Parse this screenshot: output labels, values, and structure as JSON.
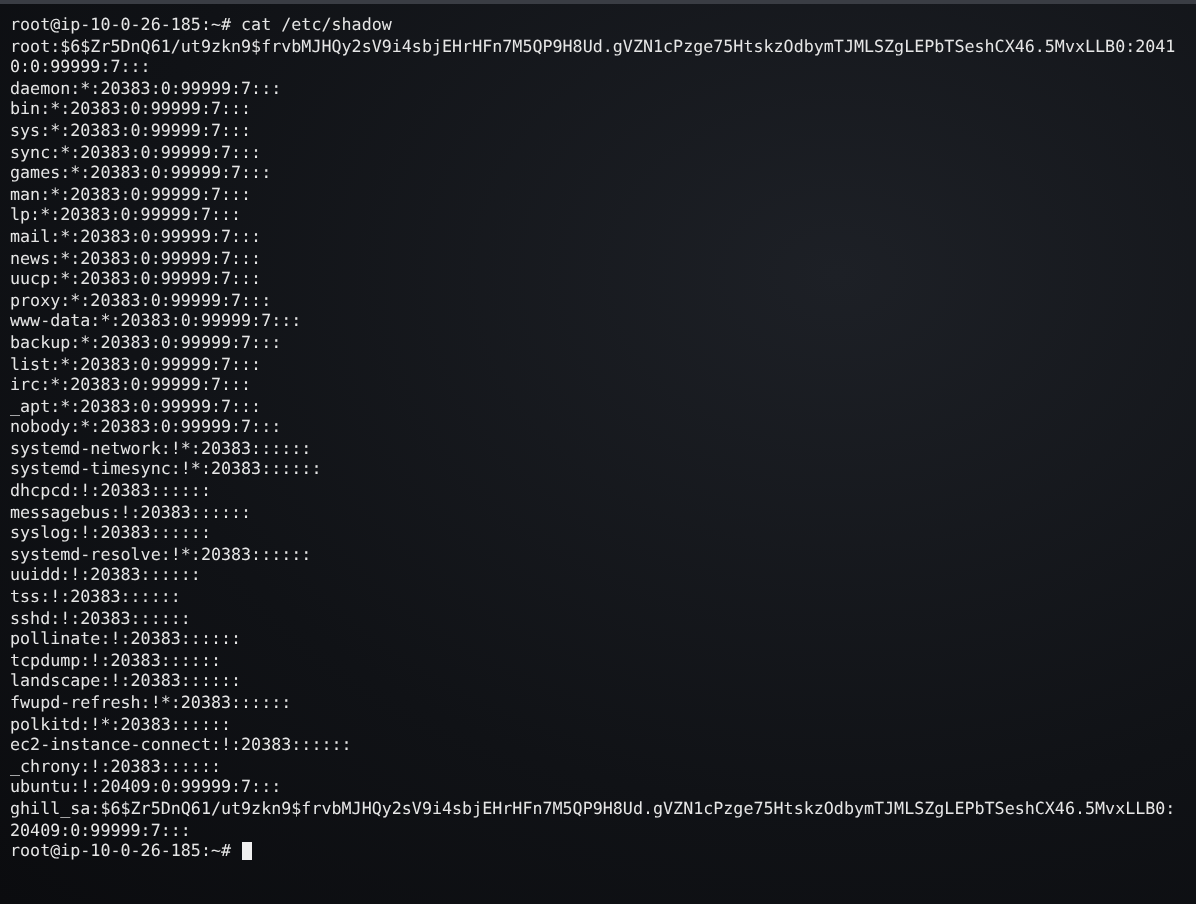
{
  "terminal": {
    "lines": [
      "root@ip-10-0-26-185:~# cat /etc/shadow",
      "root:$6$Zr5DnQ61/ut9zkn9$frvbMJHQy2sV9i4sbjEHrHFn7M5QP9H8Ud.gVZN1cPzge75HtskzOdbymTJMLSZgLEPbTSeshCX46.5MvxLLB0:2041",
      "0:0:99999:7:::",
      "daemon:*:20383:0:99999:7:::",
      "bin:*:20383:0:99999:7:::",
      "sys:*:20383:0:99999:7:::",
      "sync:*:20383:0:99999:7:::",
      "games:*:20383:0:99999:7:::",
      "man:*:20383:0:99999:7:::",
      "lp:*:20383:0:99999:7:::",
      "mail:*:20383:0:99999:7:::",
      "news:*:20383:0:99999:7:::",
      "uucp:*:20383:0:99999:7:::",
      "proxy:*:20383:0:99999:7:::",
      "www-data:*:20383:0:99999:7:::",
      "backup:*:20383:0:99999:7:::",
      "list:*:20383:0:99999:7:::",
      "irc:*:20383:0:99999:7:::",
      "_apt:*:20383:0:99999:7:::",
      "nobody:*:20383:0:99999:7:::",
      "systemd-network:!*:20383::::::",
      "systemd-timesync:!*:20383::::::",
      "dhcpcd:!:20383::::::",
      "messagebus:!:20383::::::",
      "syslog:!:20383::::::",
      "systemd-resolve:!*:20383::::::",
      "uuidd:!:20383::::::",
      "tss:!:20383::::::",
      "sshd:!:20383::::::",
      "pollinate:!:20383::::::",
      "tcpdump:!:20383::::::",
      "landscape:!:20383::::::",
      "fwupd-refresh:!*:20383::::::",
      "polkitd:!*:20383::::::",
      "ec2-instance-connect:!:20383::::::",
      "_chrony:!:20383::::::",
      "ubuntu:!:20409:0:99999:7:::",
      "ghill_sa:$6$Zr5DnQ61/ut9zkn9$frvbMJHQy2sV9i4sbjEHrHFn7M5QP9H8Ud.gVZN1cPzge75HtskzOdbymTJMLSZgLEPbTSeshCX46.5MvxLLB0:",
      "20409:0:99999:7:::"
    ],
    "prompt": "root@ip-10-0-26-185:~#"
  }
}
